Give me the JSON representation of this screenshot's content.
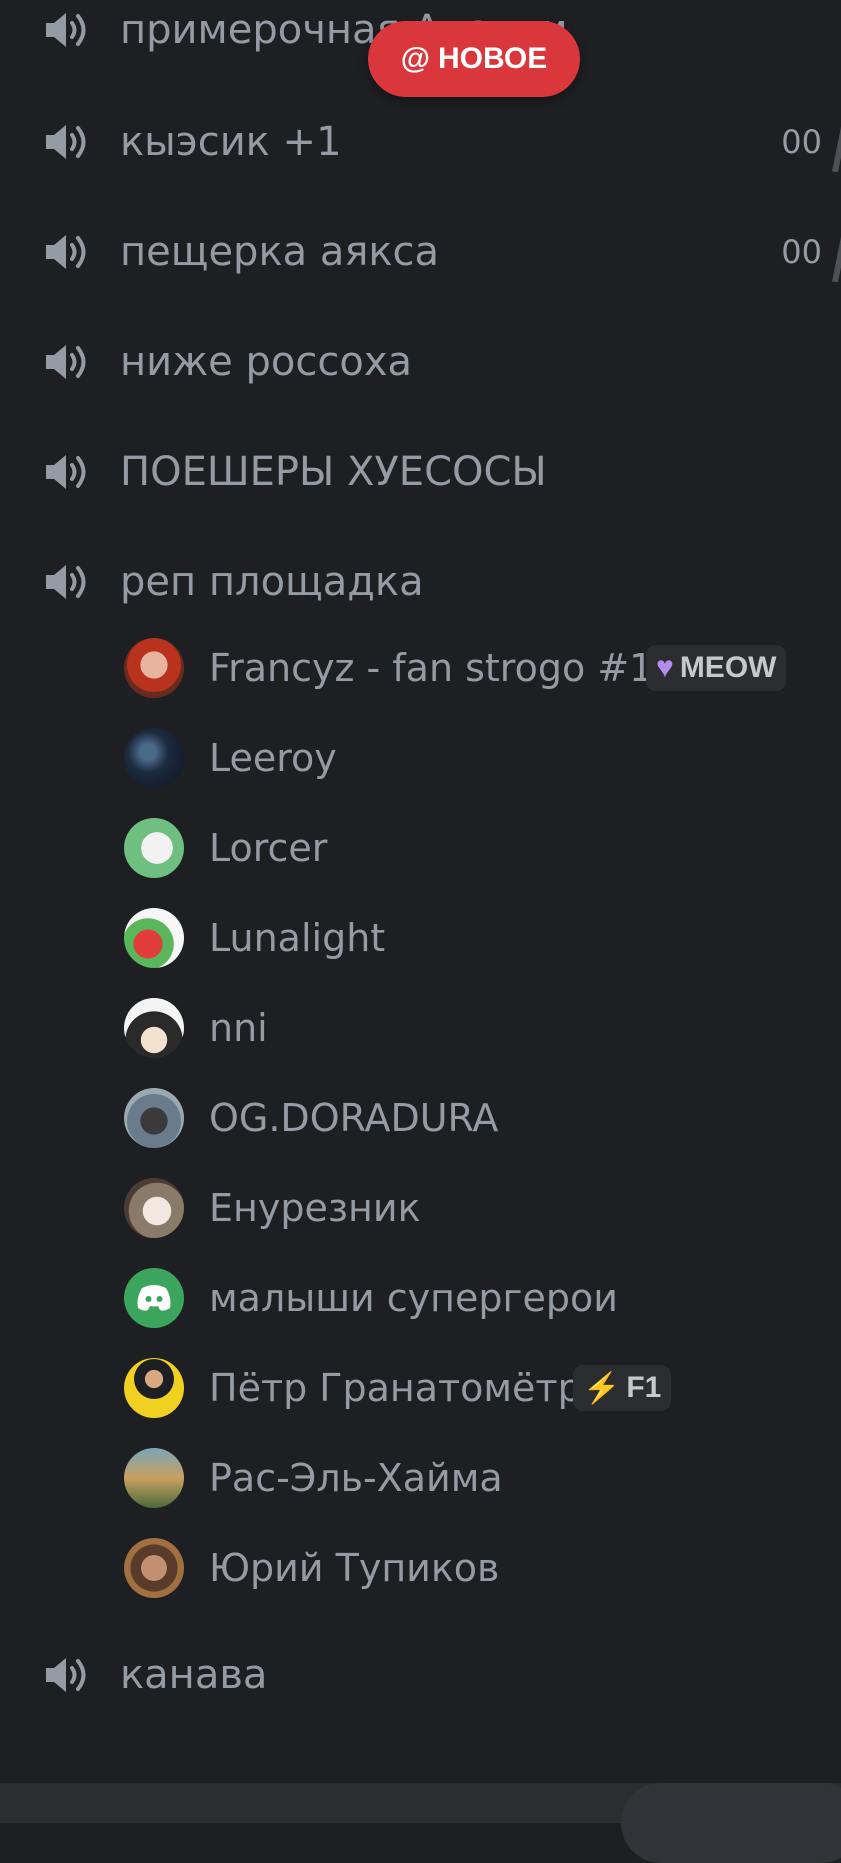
{
  "new_pill": {
    "label": "НОВОЕ",
    "icon": "at-icon"
  },
  "channels": [
    {
      "name": "примерочная Анапки",
      "limit": ""
    },
    {
      "name": "кыэсик +1",
      "limit": "00"
    },
    {
      "name": "пещерка аякса",
      "limit": "00"
    },
    {
      "name": "ниже россоха",
      "limit": ""
    },
    {
      "name": "ПОЕШЕРЫ ХУЕСОСЫ",
      "limit": ""
    },
    {
      "name": "реп площадка",
      "limit": ""
    }
  ],
  "members": [
    {
      "name": "Francyz - fan strogo #1",
      "tag": {
        "icon": "purple-heart-icon",
        "text": "MEOW"
      }
    },
    {
      "name": "Leeroy"
    },
    {
      "name": "Lorcer"
    },
    {
      "name": "Lunalight"
    },
    {
      "name": "nni"
    },
    {
      "name": "OG.DORADURA"
    },
    {
      "name": "Енурезник"
    },
    {
      "name": "малыши супергерои"
    },
    {
      "name": "Пётр Гранатомётр",
      "tag": {
        "icon": "lightning-icon",
        "text": "F1"
      }
    },
    {
      "name": "Рас-Эль-Хайма"
    },
    {
      "name": "Юрий Тупиков"
    }
  ],
  "last_channel": {
    "name": "канава"
  },
  "colors": {
    "background": "#1e1f22",
    "text": "#949ba4",
    "pill": "#da373c",
    "tag_bg": "#2b2d31"
  }
}
